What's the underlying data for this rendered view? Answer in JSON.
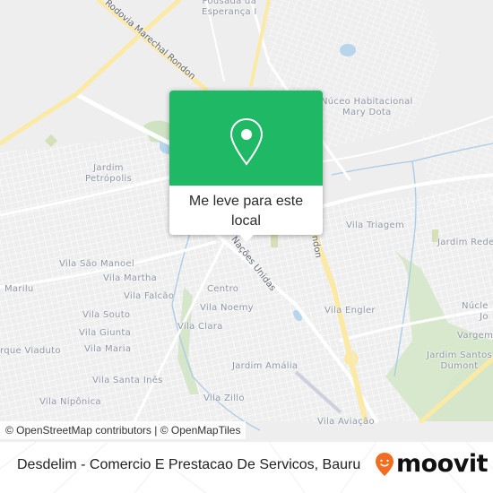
{
  "map": {
    "labels": [
      {
        "name": "pousada-da-esperanca",
        "text": "Pousada da\nEsperança I"
      },
      {
        "name": "nucleo-mary-dota",
        "text": "Núceo Habitacional\nMary Dota"
      },
      {
        "name": "jardim-petropolis",
        "text": "Jardim\nPetrópolis"
      },
      {
        "name": "vila-triagem",
        "text": "Vila Triagem"
      },
      {
        "name": "jardim-redentor",
        "text": "Jardim Rede"
      },
      {
        "name": "vila-sao-manoel",
        "text": "Vila São Manoel"
      },
      {
        "name": "vila-martha",
        "text": "Vila Martha"
      },
      {
        "name": "marilu",
        "text": "Marilu"
      },
      {
        "name": "vila-falcao",
        "text": "Vila Falcão"
      },
      {
        "name": "centro",
        "text": "Centro"
      },
      {
        "name": "vila-noemy",
        "text": "Vila Noemy"
      },
      {
        "name": "vila-engler",
        "text": "Vila Engler"
      },
      {
        "name": "nucleo-jose",
        "text": "Núcle\nJo"
      },
      {
        "name": "vila-souto",
        "text": "Vila Souto"
      },
      {
        "name": "vila-giunta",
        "text": "Vila Giunta"
      },
      {
        "name": "vila-clara",
        "text": "Vila Clara"
      },
      {
        "name": "parque-viaduto",
        "text": "rque Viaduto"
      },
      {
        "name": "vila-maria",
        "text": "Vila Maria"
      },
      {
        "name": "vargem",
        "text": "Vargem"
      },
      {
        "name": "jardim-santos-dumont",
        "text": "Jardim Santos\nDumont"
      },
      {
        "name": "jardim-amalia",
        "text": "Jardim Amália"
      },
      {
        "name": "vila-santa-ines",
        "text": "Vila Santa Inês"
      },
      {
        "name": "vila-zillo",
        "text": "Vila Zillo"
      },
      {
        "name": "vila-niponica",
        "text": "Vila Nipônica"
      },
      {
        "name": "vila-aviacao",
        "text": "Vila Aviação"
      }
    ],
    "roads": {
      "marechal_rondon": "Rodovia Marechal Rondon",
      "rondon_short": "ndon",
      "nacoes_unidas": "Nações Unidas"
    },
    "attribution": "© OpenStreetMap contributors | © OpenMapTiles"
  },
  "popup": {
    "icon": "map-pin-icon",
    "action_label": "Me leve para este local"
  },
  "footer": {
    "title": "Desdelim - Comercio E Prestacao De Servicos, Bauru",
    "brand": "moovit",
    "brand_icon": "moovit-smiley-pin-icon",
    "brand_color": "#f26d21"
  }
}
